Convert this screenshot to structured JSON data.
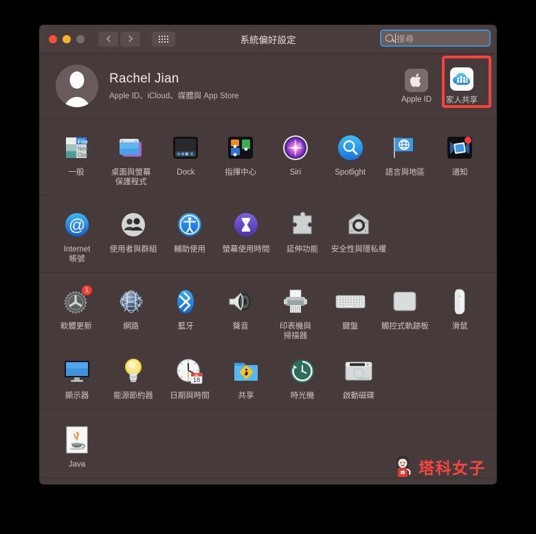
{
  "window": {
    "title": "系統偏好設定",
    "traffic_lights": [
      "close",
      "minimize",
      "zoom"
    ],
    "nav": {
      "back": "‹",
      "forward": "›",
      "grid": "show-all"
    }
  },
  "search": {
    "placeholder": "搜尋",
    "value": "",
    "focused": true,
    "accent": "#3d8fd4"
  },
  "banner": {
    "name": "Rachel Jian",
    "subtitle": "Apple ID、iCloud、媒體與 App Store",
    "items": [
      {
        "label": "Apple ID",
        "icon": "apple-logo-icon",
        "highlighted": false
      },
      {
        "label": "家人共享",
        "icon": "family-sharing-icon",
        "highlighted": true
      }
    ],
    "highlight_color": "#f9423a"
  },
  "sections": [
    {
      "name": "personal",
      "items": [
        {
          "label": "一般",
          "icon": "general-icon"
        },
        {
          "label": "桌面與螢幕\n保護程式",
          "icon": "desktop-screensaver-icon"
        },
        {
          "label": "Dock",
          "icon": "dock-icon"
        },
        {
          "label": "指揮中心",
          "icon": "mission-control-icon"
        },
        {
          "label": "Siri",
          "icon": "siri-icon"
        },
        {
          "label": "Spotlight",
          "icon": "spotlight-icon"
        },
        {
          "label": "語言與地區",
          "icon": "language-region-icon"
        },
        {
          "label": "通知",
          "icon": "notifications-icon"
        }
      ]
    },
    {
      "name": "accounts",
      "items": [
        {
          "label": "Internet\n帳號",
          "icon": "internet-accounts-icon"
        },
        {
          "label": "使用者與群組",
          "icon": "users-groups-icon"
        },
        {
          "label": "輔助使用",
          "icon": "accessibility-icon"
        },
        {
          "label": "螢幕使用時間",
          "icon": "screen-time-icon"
        },
        {
          "label": "延伸功能",
          "icon": "extensions-icon"
        },
        {
          "label": "安全性與隱私權",
          "icon": "security-privacy-icon"
        }
      ]
    },
    {
      "name": "hardware",
      "items": [
        {
          "label": "軟體更新",
          "icon": "software-update-icon",
          "badge": "1"
        },
        {
          "label": "網路",
          "icon": "network-icon"
        },
        {
          "label": "藍牙",
          "icon": "bluetooth-icon"
        },
        {
          "label": "聲音",
          "icon": "sound-icon"
        },
        {
          "label": "印表機與\n掃描器",
          "icon": "printers-scanners-icon"
        },
        {
          "label": "鍵盤",
          "icon": "keyboard-icon"
        },
        {
          "label": "觸控式軌跡板",
          "icon": "trackpad-icon"
        },
        {
          "label": "滑鼠",
          "icon": "mouse-icon"
        },
        {
          "label": "顯示器",
          "icon": "displays-icon"
        },
        {
          "label": "能源節約器",
          "icon": "energy-saver-icon"
        },
        {
          "label": "日期與時間",
          "icon": "date-time-icon",
          "calendar_month": "JUL",
          "calendar_day": "18"
        },
        {
          "label": "共享",
          "icon": "sharing-icon"
        },
        {
          "label": "時光機",
          "icon": "time-machine-icon"
        },
        {
          "label": "啟動磁碟",
          "icon": "startup-disk-icon"
        }
      ]
    },
    {
      "name": "other",
      "items": [
        {
          "label": "Java",
          "icon": "java-icon"
        }
      ]
    }
  ],
  "watermark": {
    "text": "塔科女子",
    "color": "#f4473f",
    "mascot_badge": "3C"
  }
}
